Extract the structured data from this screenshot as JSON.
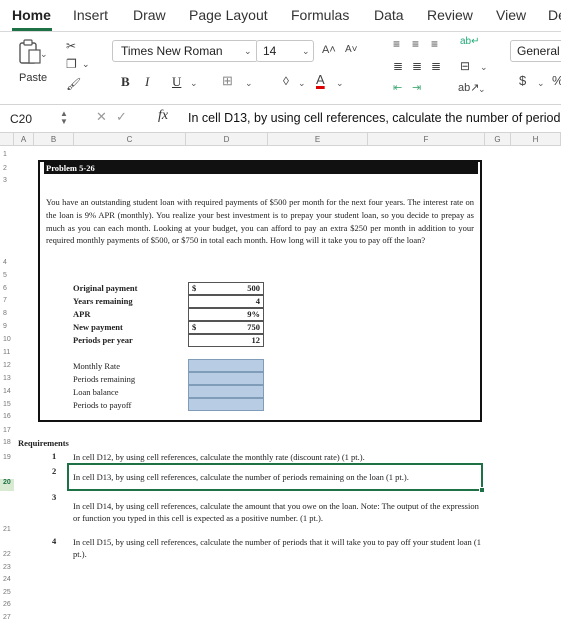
{
  "ribbon_tabs": [
    "Home",
    "Insert",
    "Draw",
    "Page Layout",
    "Formulas",
    "Data",
    "Review",
    "View",
    "De"
  ],
  "ribbon": {
    "paste_label": "Paste",
    "font_name": "Times New Roman",
    "font_size": "14",
    "number_format": "General",
    "bold": "B",
    "italic": "I",
    "underline": "U",
    "currency": "$",
    "percent": "%"
  },
  "formula_bar": {
    "cell_ref": "C20",
    "fx": "fx",
    "formula": "In cell D13, by using cell references, calculate the number of period"
  },
  "columns": [
    "A",
    "B",
    "C",
    "D",
    "E",
    "F",
    "G",
    "H"
  ],
  "rows": [
    "1",
    "2",
    "3",
    "4",
    "5",
    "6",
    "7",
    "8",
    "9",
    "10",
    "11",
    "12",
    "13",
    "14",
    "15",
    "16",
    "17",
    "18",
    "19",
    "20",
    "21",
    "22",
    "23",
    "24",
    "25",
    "26",
    "27"
  ],
  "problem": {
    "title": "Problem 5-26",
    "text": "You have an outstanding student loan with required payments of $500 per month for the next four years. The interest rate on the loan is 9% APR (monthly). You realize your best investment is to prepay your student loan, so you decide to prepay as much as you can each month. Looking at your budget, you can afford to pay an extra $250 per month in addition to your required monthly payments of $500, or $750 in total each month. How long will it take you to pay off the loan?",
    "inputs": [
      {
        "label": "Original payment",
        "currency": "$",
        "value": "500"
      },
      {
        "label": "Years remaining",
        "currency": "",
        "value": "4"
      },
      {
        "label": "APR",
        "currency": "",
        "value": "9%"
      },
      {
        "label": "New payment",
        "currency": "$",
        "value": "750"
      },
      {
        "label": "Periods per year",
        "currency": "",
        "value": "12"
      }
    ],
    "outputs": [
      "Monthly Rate",
      "Periods remaining",
      "Loan balance",
      "Periods to payoff"
    ]
  },
  "requirements": {
    "title": "Requirements",
    "items": [
      {
        "num": "1",
        "text": "In cell D12, by using cell references, calculate the  monthly rate (discount rate) (1 pt.)."
      },
      {
        "num": "2",
        "text": "In cell D13, by using cell references, calculate the number of periods remaining on the loan (1 pt.)."
      },
      {
        "num": "3",
        "text": "In cell D14, by using cell references, calculate the amount that you owe on the loan.  Note:  The output of the expression or function you typed in this cell is expected as a positive number. (1 pt.)."
      },
      {
        "num": "4",
        "text": "In cell D15, by using cell references, calculate the number of periods that it will take you to pay off your student loan (1 pt.)."
      }
    ]
  },
  "colors": {
    "accent": "#1e7145",
    "output_fill": "#b8cce4"
  }
}
